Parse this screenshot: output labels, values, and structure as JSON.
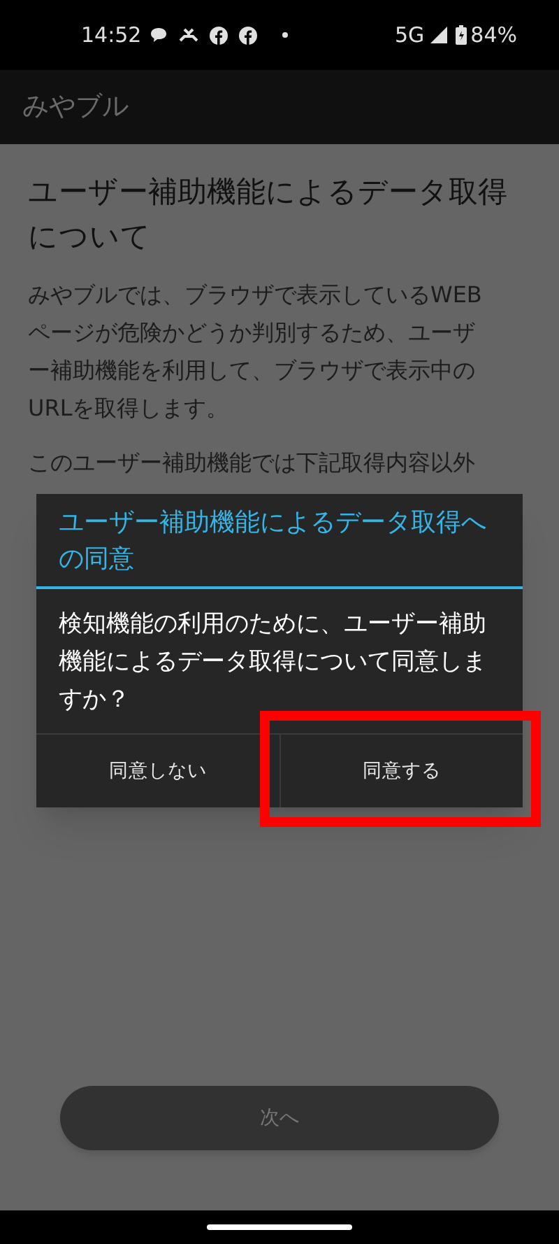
{
  "status_bar": {
    "time": "14:52",
    "network": "5G",
    "battery": "84%"
  },
  "app_bar": {
    "title": "みやブル"
  },
  "content": {
    "title": "ユーザー補助機能によるデータ取得について",
    "paragraphs": [
      "みやブルでは、ブラウザで表示しているWEBページが危険かどうか判別するため、ユーザー補助機能を利用して、ブラウザで表示中のURLを取得します。",
      "このユーザー補助機能では下記取得内容以外"
    ]
  },
  "dialog": {
    "title": "ユーザー補助機能によるデータ取得への同意",
    "message": "検知機能の利用のために、ユーザー補助機能によるデータ取得について同意しますか？",
    "buttons": [
      {
        "label": "同意しない",
        "highlighted": false
      },
      {
        "label": "同意する",
        "highlighted": true
      }
    ]
  },
  "next_button": {
    "label": "次へ",
    "disabled": true
  }
}
